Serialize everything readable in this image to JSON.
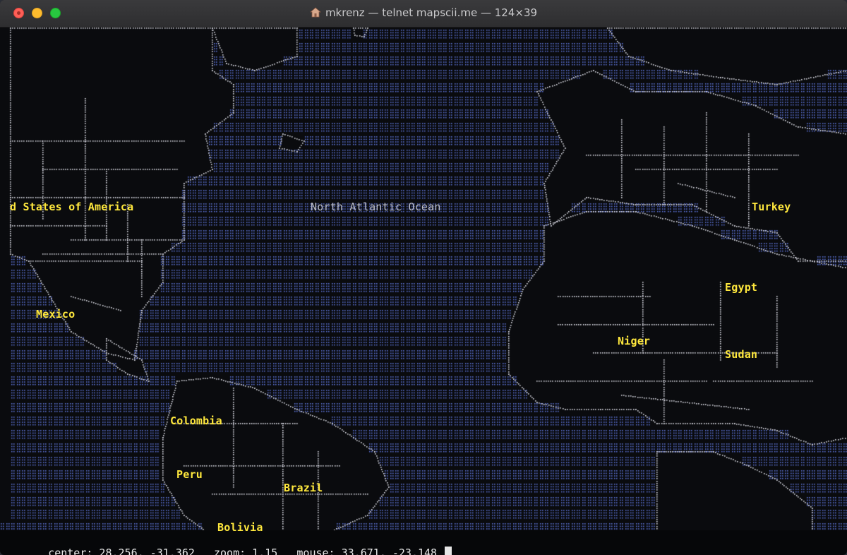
{
  "window": {
    "title": "mkrenz — telnet mapscii.me — 124×39"
  },
  "map": {
    "ocean_color": "#5c72d6",
    "land_color": "#0a0b0e",
    "border_color": "#dcdce6",
    "labels": {
      "usa": "d States of America",
      "north_atlantic": "North Atlantic Ocean",
      "turkey": "Turkey",
      "mexico": "Mexico",
      "egypt": "Egypt",
      "niger": "Niger",
      "sudan": "Sudan",
      "colombia": "Colombia",
      "peru": "Peru",
      "brazil": "Brazil",
      "bolivia": "Bolivia"
    }
  },
  "status": {
    "center": "center: 28.256, -31.362",
    "zoom": "zoom: 1.15",
    "mouse": "mouse: 33.671, -23.148"
  }
}
